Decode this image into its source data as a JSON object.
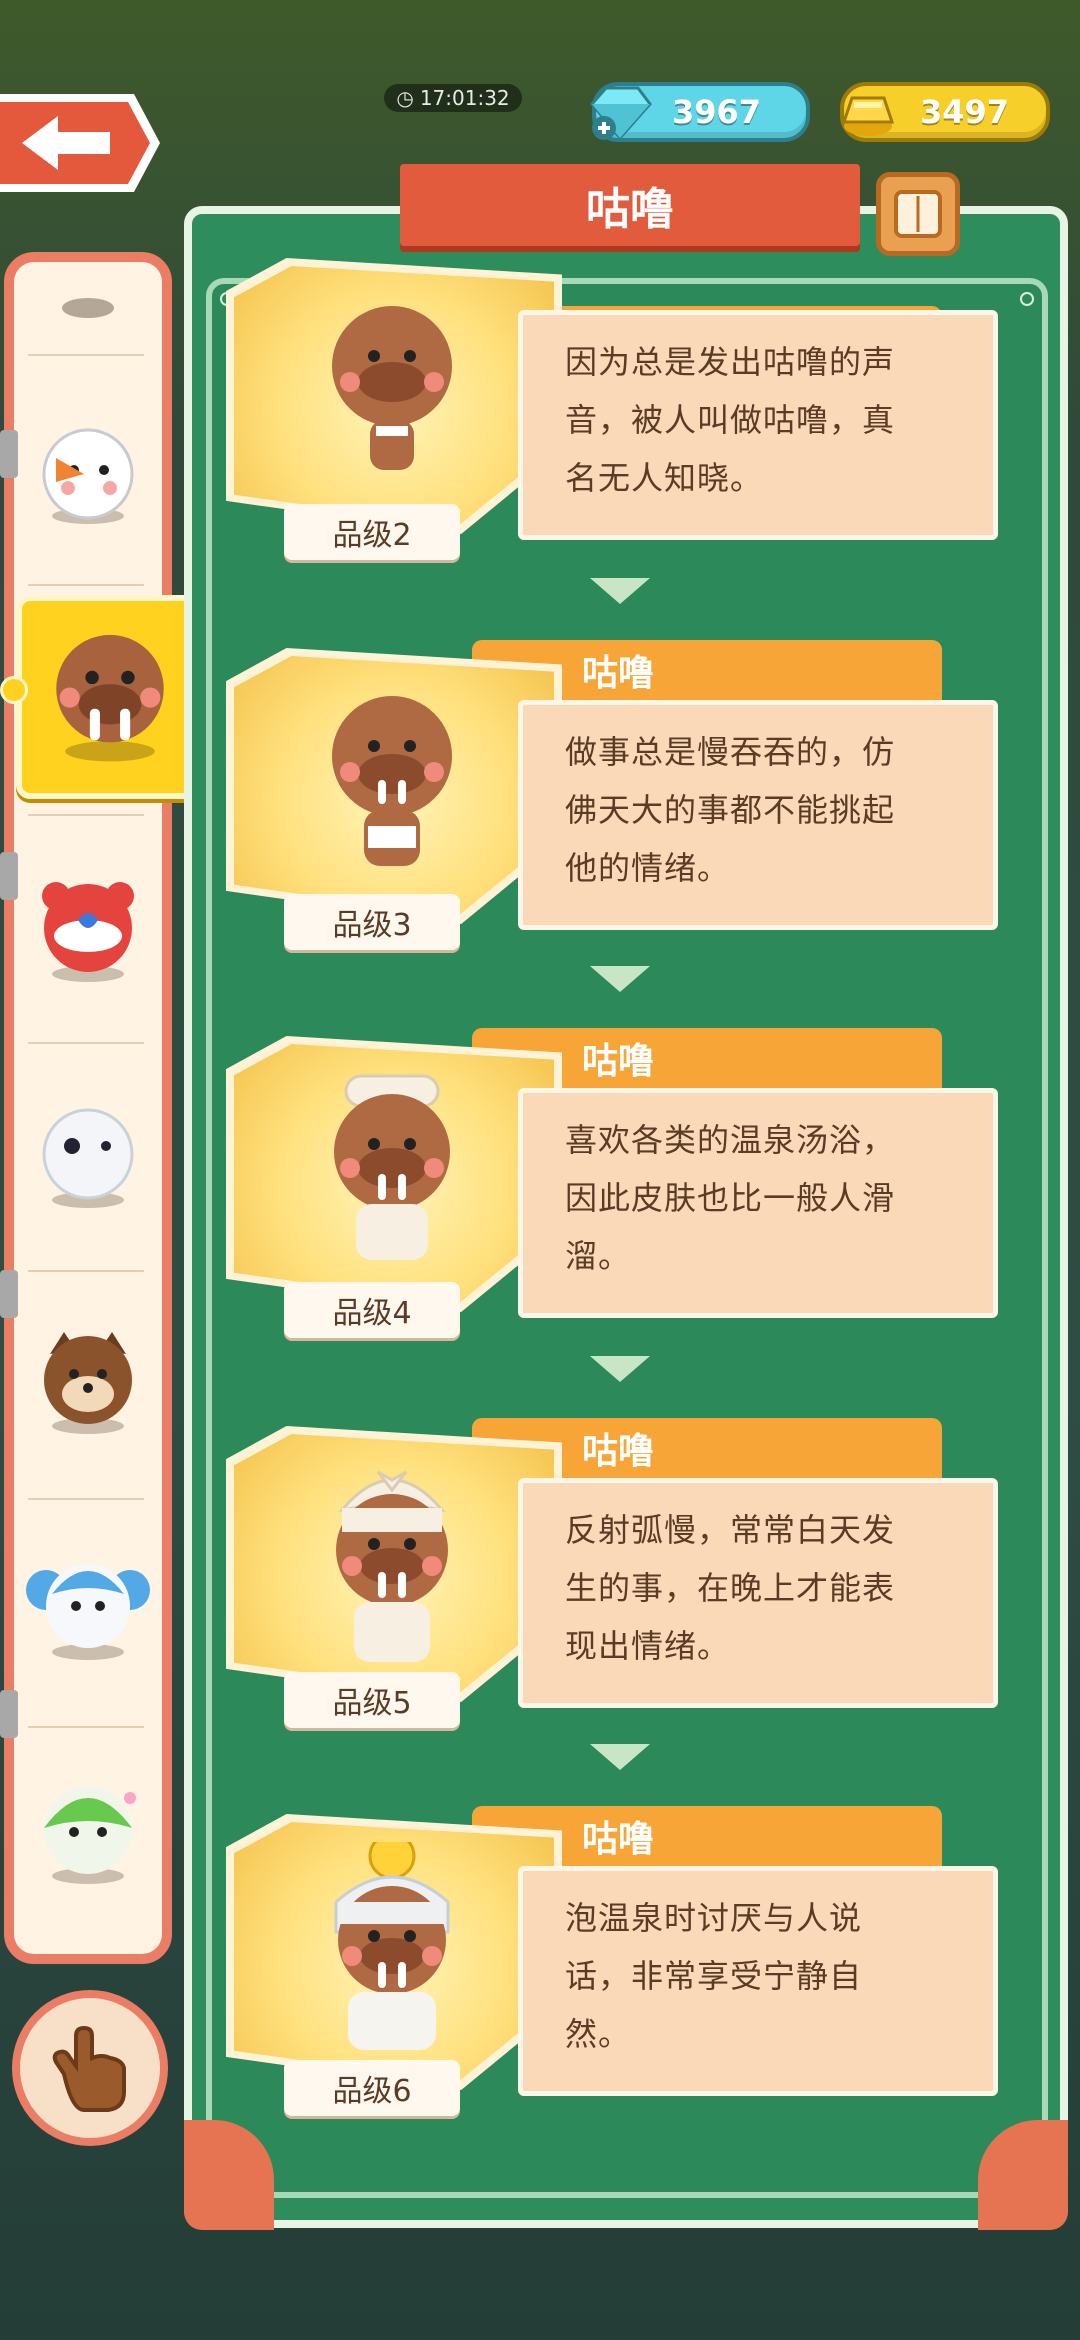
{
  "hud": {
    "time": "17:01:32",
    "gems": "3967",
    "gold": "3497"
  },
  "title": "咕噜",
  "colors": {
    "accent_red": "#e25b3d",
    "panel_green": "#2e8d5c",
    "tab_orange": "#f7a537",
    "desc_bg": "#f9d9b8",
    "text_brown": "#5b3b25",
    "gem_cyan": "#5fd6e7",
    "gold_yellow": "#f7cf2b"
  },
  "sidebar": {
    "items": [
      {
        "name": "snowman-icon"
      },
      {
        "name": "walrus-icon",
        "selected": true
      },
      {
        "name": "red-bear-icon"
      },
      {
        "name": "snow-bird-icon"
      },
      {
        "name": "raccoon-icon"
      },
      {
        "name": "koala-icon"
      },
      {
        "name": "green-bird-icon"
      }
    ]
  },
  "cards": [
    {
      "name": "",
      "grade": "品级2",
      "lines": [
        "因为总是发出咕噜的声",
        "音，被人叫做咕噜，真",
        "名无人知晓。"
      ]
    },
    {
      "name": "咕噜",
      "grade": "品级3",
      "lines": [
        "做事总是慢吞吞的，仿",
        "佛天大的事都不能挑起",
        "他的情绪。"
      ]
    },
    {
      "name": "咕噜",
      "grade": "品级4",
      "lines": [
        "喜欢各类的温泉汤浴，",
        "因此皮肤也比一般人滑",
        "溜。"
      ]
    },
    {
      "name": "咕噜",
      "grade": "品级5",
      "lines": [
        "反射弧慢，常常白天发",
        "生的事，在晚上才能表",
        "现出情绪。"
      ]
    },
    {
      "name": "咕噜",
      "grade": "品级6",
      "lines": [
        "泡温泉时讨厌与人说",
        "话，非常享受宁静自",
        "然。"
      ]
    }
  ]
}
